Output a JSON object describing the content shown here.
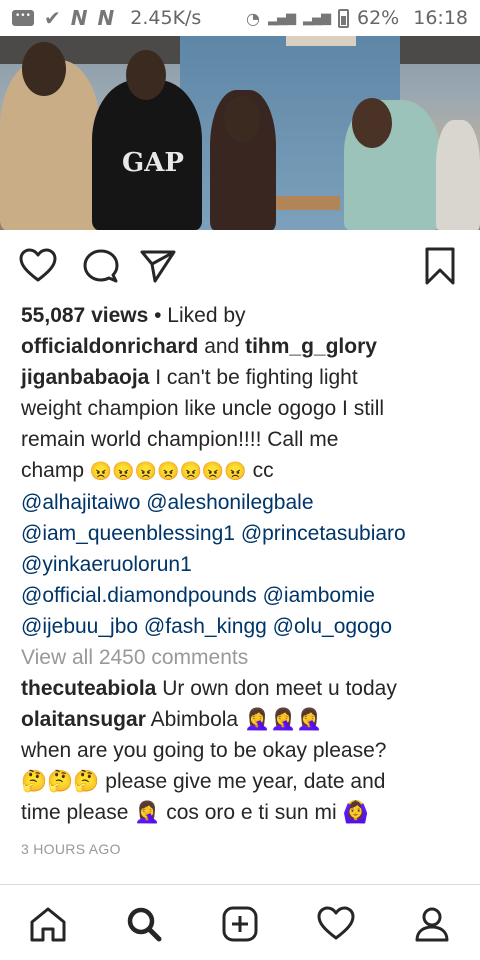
{
  "status_bar": {
    "n1": "N",
    "n2": "N",
    "speed": "2.45K/s",
    "battery": "62%",
    "time": "16:18"
  },
  "post": {
    "image_text": "GAP",
    "views": "55,087 views",
    "liked_by_prefix": "• Liked by",
    "liker_1": "officialdonrichard",
    "and_text": "and",
    "liker_2": "tihm_g_glory",
    "author": "jiganbabaoja",
    "caption_line1": "I can't be fighting light",
    "caption_line2": "weight champion like uncle ogogo I still",
    "caption_line3": "remain world champion!!!! Call me",
    "caption_line4_text": "champ",
    "caption_line4_emoji": "😠😠😠😠😠😠😠",
    "caption_line4_cc": "cc",
    "mentions": [
      [
        "@alhajitaiwo",
        "@aleshonilegbale"
      ],
      [
        "@iam_queenblessing1",
        "@princetasubiaro"
      ],
      [
        "@yinkaeruolorun1"
      ],
      [
        "@official.diamondpounds",
        "@iambomie"
      ],
      [
        "@ijebuu_jbo",
        "@fash_kingg",
        "@olu_ogogo"
      ]
    ],
    "view_all_comments": "View all 2450 comments",
    "comments": [
      {
        "user": "thecuteabiola",
        "lines": [
          "Ur own don meet u today"
        ]
      },
      {
        "user": "olaitansugar",
        "lines": [
          "Abimbola 🤦‍♀️🤦‍♀️🤦‍♀️",
          "when are you going to be okay please?",
          "🤔🤔🤔 please give me year, date and",
          "time please 🤦‍♀️ cos oro e ti sun mi 🙆‍♀️"
        ]
      }
    ],
    "timestamp": "3 HOURS AGO"
  },
  "icons": {
    "like": "heart-icon",
    "comment": "comment-icon",
    "share": "send-icon",
    "save": "bookmark-icon",
    "home": "home-icon",
    "search": "search-icon",
    "new_post": "add-post-icon",
    "activity": "activity-heart-icon",
    "profile": "profile-icon"
  },
  "colors": {
    "text": "#262626",
    "muted": "#999999",
    "mention": "#003569",
    "divider": "#dbdbdb"
  }
}
